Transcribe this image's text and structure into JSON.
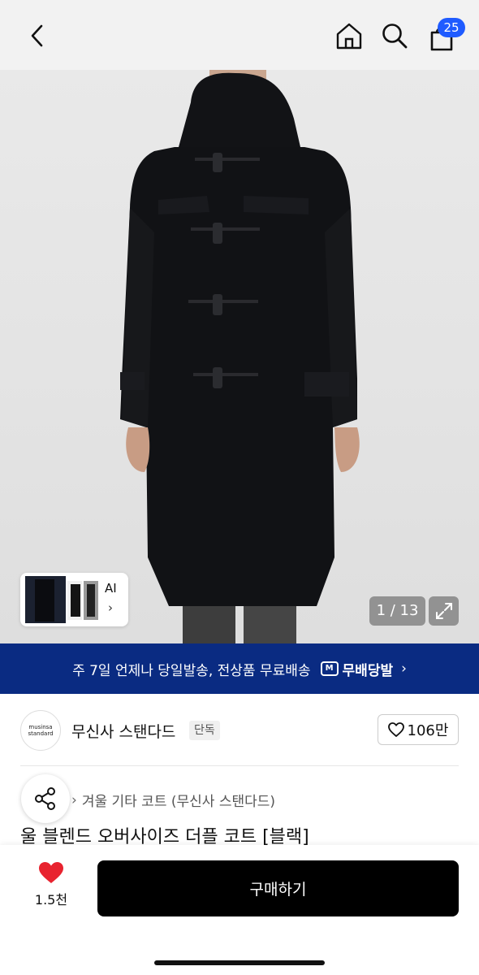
{
  "header": {
    "back_icon": "chevron-left-icon",
    "home_icon": "home-icon",
    "search_icon": "search-icon",
    "cart_icon": "shopping-bag-icon",
    "cart_count": "25",
    "badge_color": "#1f5bff"
  },
  "gallery": {
    "ai_label": "AI",
    "ai_chevron": "›",
    "counter": "1 / 13",
    "expand_icon": "expand-icon"
  },
  "banner": {
    "text": "주 7일 언제나 당일발송, 전상품 무료배송",
    "service_logo_letter": "M",
    "service_name": "무배당발",
    "chevron": "›",
    "background": "#0a2b82"
  },
  "brand": {
    "logo_line1": "musinsa",
    "logo_line2": "standard",
    "name": "무신사 스탠다드",
    "badge": "단독",
    "like_count": "106만"
  },
  "product": {
    "breadcrumb_sep": "›",
    "breadcrumb": "겨울 기타 코트 (무신사 스탠다드)",
    "title": "울 블렌드 오버사이즈 더플 코트 [블랙]"
  },
  "bottom": {
    "like_count": "1.5천",
    "buy_label": "구매하기",
    "heart_color": "#e8232f"
  }
}
